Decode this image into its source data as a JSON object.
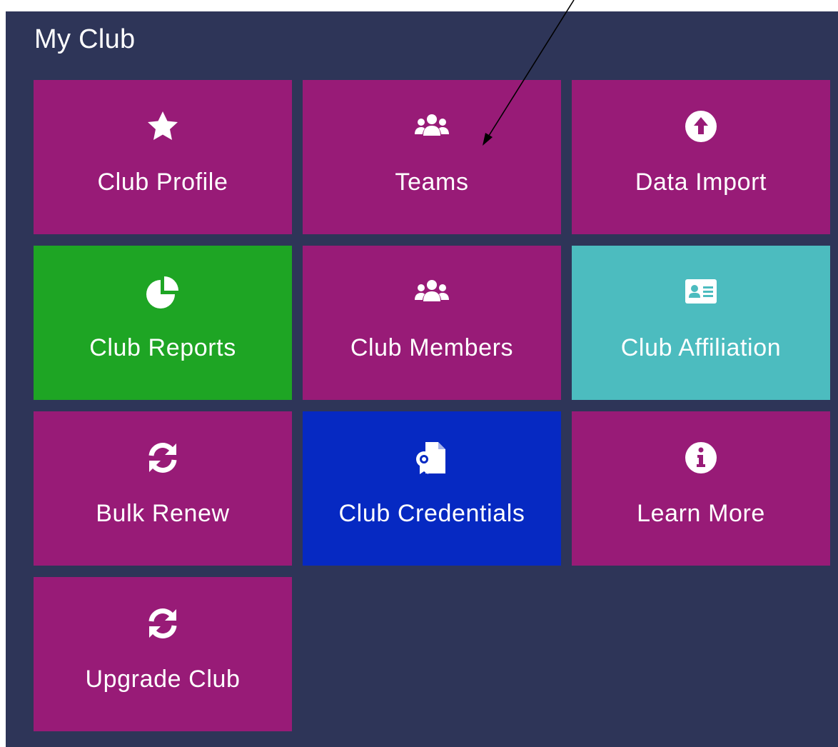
{
  "panel": {
    "title": "My Club"
  },
  "colors": {
    "panel_bg": "#2e3558",
    "magenta": "#981b77",
    "green": "#1ea524",
    "teal": "#4cbcbf",
    "blue": "#0629c2"
  },
  "tiles": [
    {
      "label": "Club Profile",
      "icon": "star-icon",
      "color": "#981b77"
    },
    {
      "label": "Teams",
      "icon": "users-icon",
      "color": "#981b77"
    },
    {
      "label": "Data Import",
      "icon": "upload-circle-icon",
      "color": "#981b77"
    },
    {
      "label": "Club Reports",
      "icon": "pie-chart-icon",
      "color": "#1ea524"
    },
    {
      "label": "Club Members",
      "icon": "users-icon",
      "color": "#981b77"
    },
    {
      "label": "Club Affiliation",
      "icon": "id-card-icon",
      "color": "#4cbcbf"
    },
    {
      "label": "Bulk Renew",
      "icon": "sync-icon",
      "color": "#981b77"
    },
    {
      "label": "Club Credentials",
      "icon": "certificate-file-icon",
      "color": "#0629c2"
    },
    {
      "label": "Learn More",
      "icon": "info-circle-icon",
      "color": "#981b77"
    },
    {
      "label": "Upgrade Club",
      "icon": "sync-icon",
      "color": "#981b77"
    }
  ]
}
